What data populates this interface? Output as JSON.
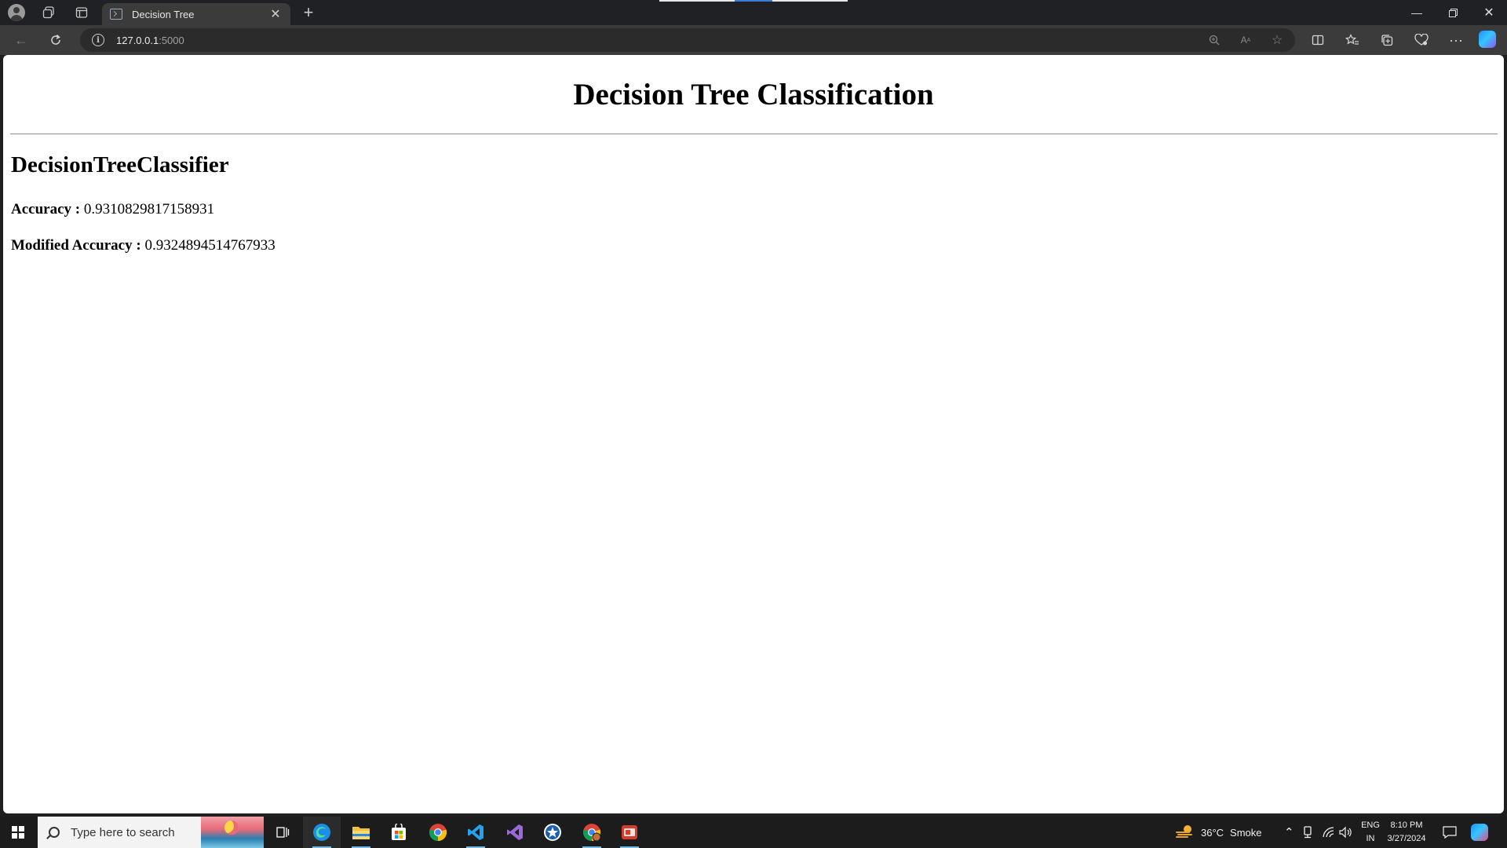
{
  "browser": {
    "tab": {
      "title": "Decision Tree"
    },
    "address": {
      "host": "127.0.0.1",
      "port": ":5000"
    }
  },
  "page": {
    "title": "Decision Tree Classification",
    "subtitle": "DecisionTreeClassifier",
    "metrics": [
      {
        "label": "Accuracy :",
        "value": "0.9310829817158931"
      },
      {
        "label": "Modified Accuracy :",
        "value": "0.9324894514767933"
      }
    ]
  },
  "taskbar": {
    "search_placeholder": "Type here to search",
    "weather": {
      "temp": "36°C",
      "condition": "Smoke"
    },
    "language": {
      "line1": "ENG",
      "line2": "IN"
    },
    "clock": {
      "time": "8:10 PM",
      "date": "3/27/2024"
    },
    "apps": [
      "task-view",
      "edge",
      "file-explorer",
      "microsoft-store",
      "chrome",
      "vscode",
      "visual-studio",
      "app-store-icon",
      "chrome-canary",
      "app-red"
    ]
  },
  "colors": {
    "tab_strip": "#202124",
    "toolbar": "#3b3b3b",
    "taskbar": "#1c1c1c",
    "accent": "#76b9ed"
  }
}
